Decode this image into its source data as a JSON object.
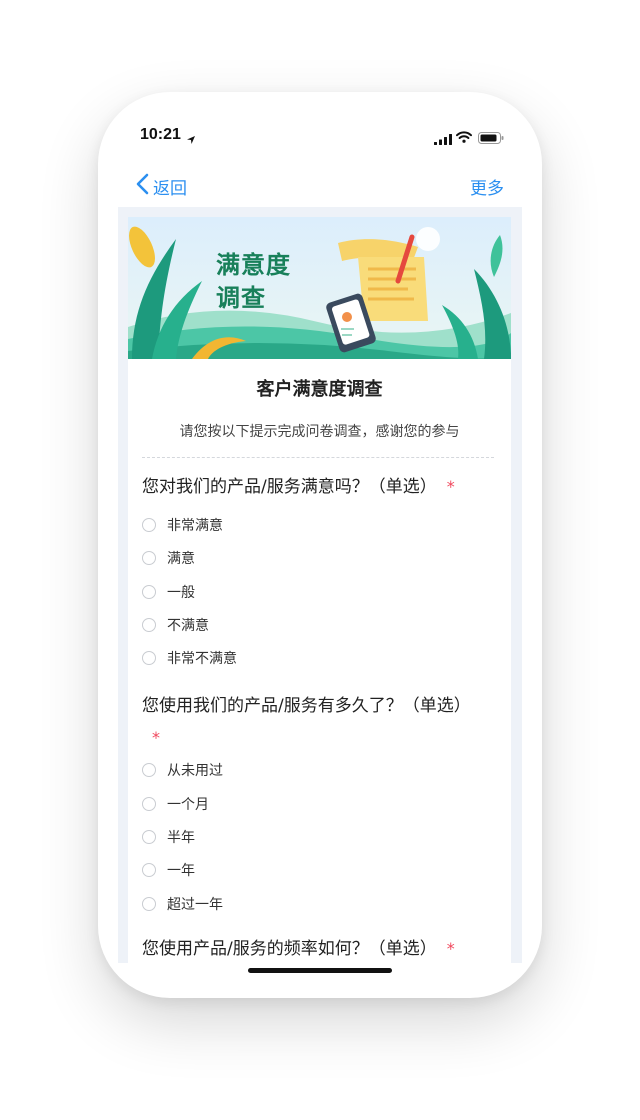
{
  "status_bar": {
    "time": "10:21"
  },
  "nav": {
    "back_label": "返回",
    "more_label": "更多"
  },
  "banner": {
    "title": "满意度调查"
  },
  "survey": {
    "title": "客户满意度调查",
    "description": "请您按以下提示完成问卷调查，感谢您的参与"
  },
  "questions": [
    {
      "text": "您对我们的产品/服务满意吗？（单选）",
      "required_mark": "*",
      "options": [
        "非常满意",
        "满意",
        "一般",
        "不满意",
        "非常不满意"
      ]
    },
    {
      "text": "您使用我们的产品/服务有多久了？（单选）",
      "required_mark": "*",
      "options": [
        "从未用过",
        "一个月",
        "半年",
        "一年",
        "超过一年"
      ]
    },
    {
      "text": "您使用产品/服务的频率如何？（单选）",
      "required_mark": "*",
      "options": []
    }
  ],
  "colors": {
    "accent": "#2b8ff0",
    "required": "#f0475c",
    "background": "#eef2f8"
  }
}
